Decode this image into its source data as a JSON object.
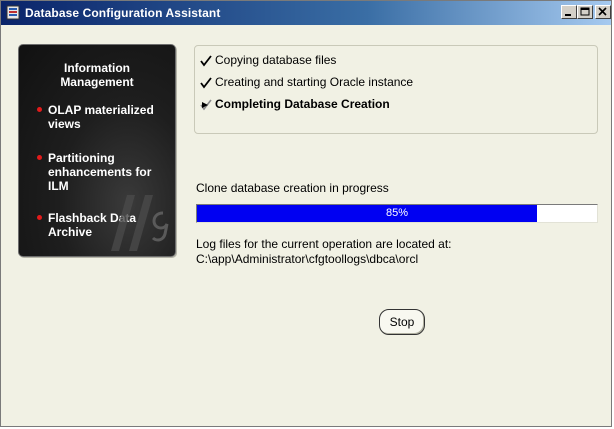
{
  "window": {
    "title": "Database Configuration Assistant"
  },
  "promo": {
    "heading_line1": "Information",
    "heading_line2": "Management",
    "items": [
      {
        "line1": "OLAP materialized",
        "line2": "views",
        "line3": ""
      },
      {
        "line1": "Partitioning",
        "line2": "enhancements for",
        "line3": "ILM"
      },
      {
        "line1": "Flashback Data",
        "line2": "Archive",
        "line3": ""
      }
    ]
  },
  "steps": [
    {
      "label": "Copying database files",
      "state": "done"
    },
    {
      "label": "Creating and starting Oracle instance",
      "state": "done"
    },
    {
      "label": "Completing Database Creation",
      "state": "current"
    }
  ],
  "status_text": "Clone database creation in progress",
  "progress": {
    "percent": 85,
    "label": "85%",
    "fill_color": "#0000f2"
  },
  "log": {
    "line1": "Log files for the current operation are located at:",
    "line2": "C:\\app\\Administrator\\cfgtoollogs\\dbca\\orcl"
  },
  "stop_label": "Stop"
}
